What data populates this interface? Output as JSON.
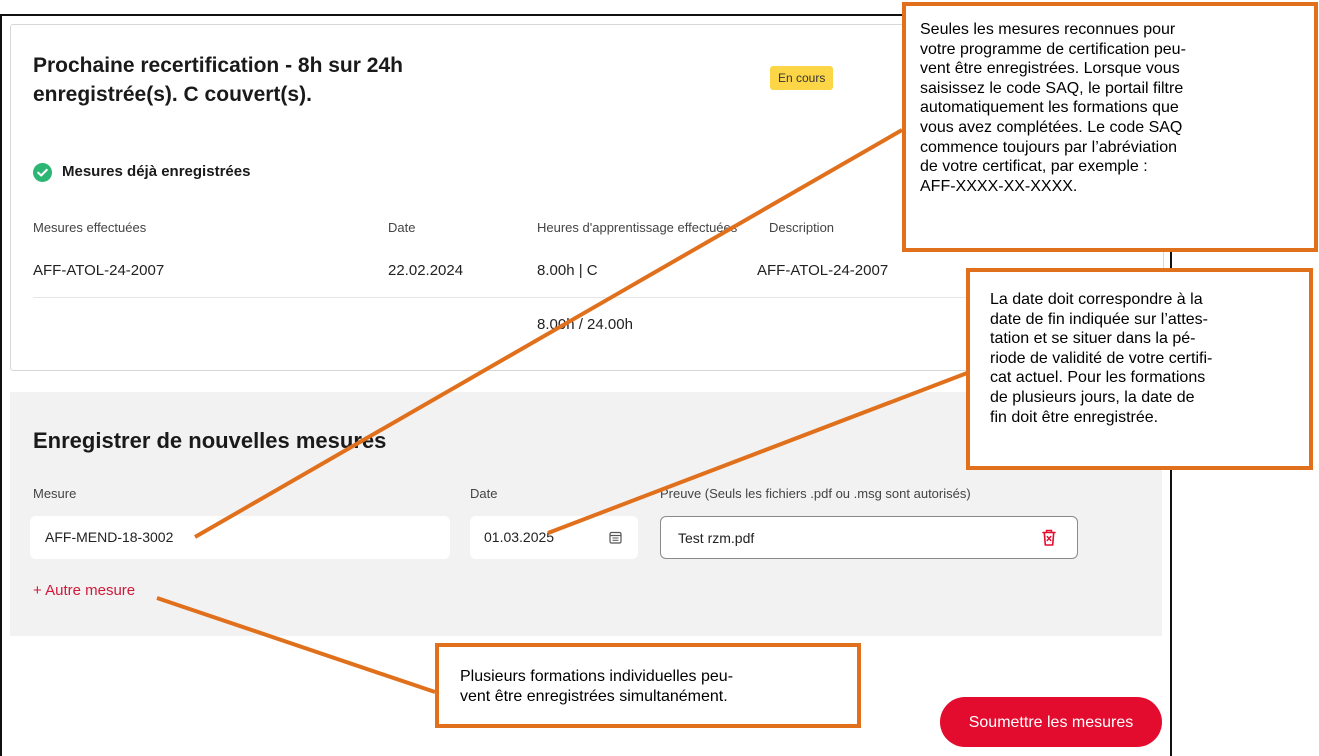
{
  "header": {
    "title": "Prochaine recertification - 8h sur 24h enregistrée(s). C couvert(s).",
    "status_badge": "En cours"
  },
  "registered": {
    "label": "Mesures déjà enregistrées",
    "icon": "check-circle-icon",
    "columns": [
      "Mesures effectuées",
      "Date",
      "Heures d'apprentissage effectuées",
      "Description"
    ],
    "rows": [
      {
        "measure": "AFF-ATOL-24-2007",
        "date": "22.02.2024",
        "hours": "8.00h | C",
        "description": "AFF-ATOL-24-2007"
      }
    ],
    "total": "8.00h / 24.00h"
  },
  "new_measures": {
    "title": "Enregistrer de nouvelles mesures",
    "measure_label": "Mesure",
    "measure_value": "AFF-MEND-18-3002",
    "date_label": "Date",
    "date_value": "01.03.2025",
    "proof_label": "Preuve (Seuls les fichiers .pdf ou .msg sont autorisés)",
    "proof_value": "Test rzm.pdf",
    "add_link": "+ Autre mesure",
    "submit": "Soumettre les mesures"
  },
  "callouts": {
    "saq_code": [
      "Seules les mesures reconnues pour",
      "votre programme de certification peu-",
      "vent être enregistrées. Lorsque vous",
      "saisissez le code SAQ, le portail filtre",
      "automatiquement les formations que",
      "vous avez complétées. Le code SAQ",
      "commence toujours par l’abréviation",
      "de votre certificat, par exemple :",
      "AFF-XXXX-XX-XXXX."
    ],
    "date": [
      "La date doit correspondre à la",
      "date de fin indiquée sur l’attes-",
      "tation et se situer dans la pé-",
      "riode de validité de votre certifi-",
      "cat actuel. Pour les formations",
      "de plusieurs jours, la date de",
      "fin doit être enregistrée."
    ],
    "multiple": [
      "Plusieurs formations individuelles peu-",
      "vent être enregistrées simultanément."
    ]
  },
  "colors": {
    "accent_red": "#e30c2f",
    "badge_yellow": "#fcd646",
    "callout_orange": "#e0701c",
    "check_green": "#2bb673"
  }
}
